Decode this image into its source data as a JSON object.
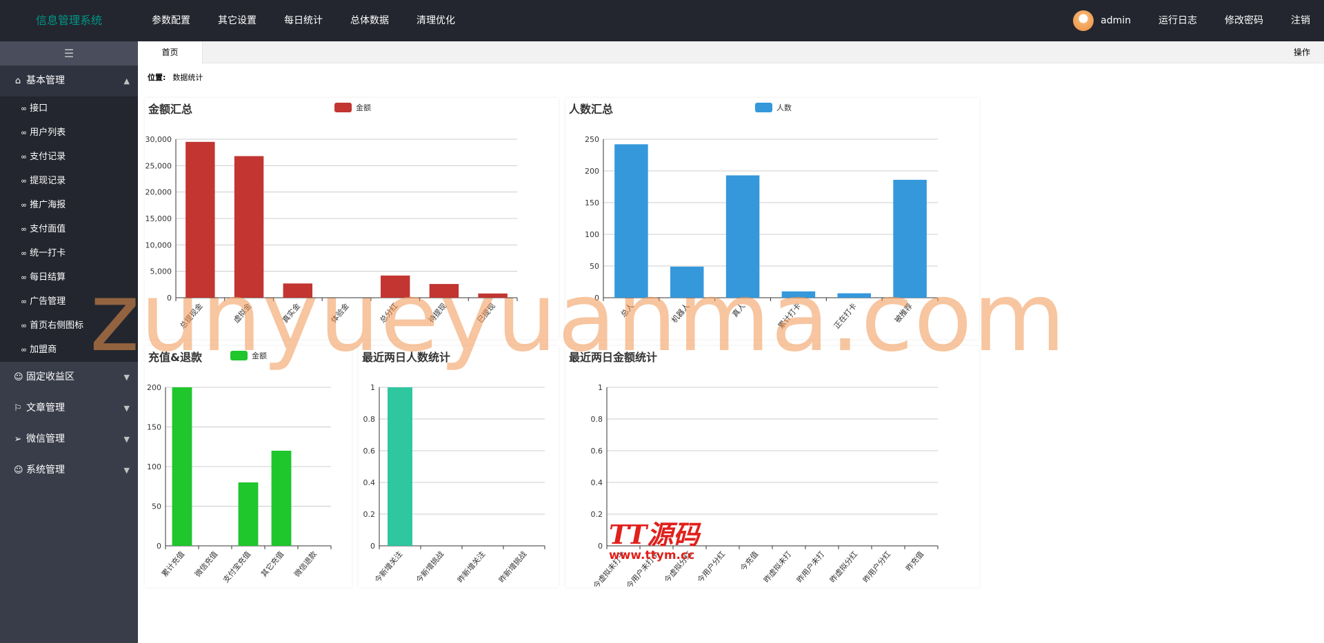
{
  "header": {
    "logo": "信息管理系统",
    "nav": [
      "参数配置",
      "其它设置",
      "每日统计",
      "总体数据",
      "清理优化"
    ],
    "user": "admin",
    "right": [
      "运行日志",
      "修改密码",
      "注销"
    ]
  },
  "sidebar": {
    "toggle_icon": "☰",
    "groups": [
      {
        "label": "基本管理",
        "open": true,
        "icon": "home-icon",
        "items": [
          "接口",
          "用户列表",
          "支付记录",
          "提现记录",
          "推广海报",
          "支付面值",
          "统一打卡",
          "每日结算",
          "广告管理",
          "首页右侧图标",
          "加盟商"
        ]
      },
      {
        "label": "固定收益区",
        "icon": "user-icon"
      },
      {
        "label": "文章管理",
        "icon": "flag-icon"
      },
      {
        "label": "微信管理",
        "icon": "send-icon"
      },
      {
        "label": "系统管理",
        "icon": "user-icon"
      }
    ]
  },
  "tabs": {
    "home": "首页",
    "ops": "操作"
  },
  "breadcrumb": {
    "label": "位置:",
    "current": "数据统计"
  },
  "watermark": {
    "text": "zunyueyuanma.com",
    "brand": "TT源码",
    "url": "www.ttym.cc"
  },
  "colors": {
    "red": "#c23531",
    "blue": "#3498db",
    "green": "#1fc62c",
    "teal": "#2ec7a0"
  },
  "chart_data": [
    {
      "id": "amount",
      "type": "bar",
      "title": "金额汇总",
      "legend": "金额",
      "color": "#c23531",
      "categories": [
        "总提现金",
        "虚拟金",
        "真实金",
        "体验金",
        "总分红",
        "待提现",
        "已提现"
      ],
      "values": [
        29500,
        26800,
        2700,
        0,
        4200,
        2600,
        800
      ],
      "ylim": [
        0,
        30000
      ],
      "yticks": [
        "0",
        "5,000",
        "10,000",
        "15,000",
        "20,000",
        "25,000",
        "30,000"
      ]
    },
    {
      "id": "people",
      "type": "bar",
      "title": "人数汇总",
      "legend": "人数",
      "color": "#3498db",
      "categories": [
        "总人",
        "机器人",
        "真人",
        "累计打卡",
        "正在打卡",
        "被推荐"
      ],
      "values": [
        242,
        49,
        193,
        10,
        7,
        186
      ],
      "ylim": [
        0,
        250
      ],
      "yticks": [
        "0",
        "50",
        "100",
        "150",
        "200",
        "250"
      ]
    },
    {
      "id": "recharge",
      "type": "bar",
      "title": "充值&退款",
      "legend": "金额",
      "color": "#1fc62c",
      "categories": [
        "累计充值",
        "微信充值",
        "支付宝充值",
        "其它充值",
        "微信退款"
      ],
      "values": [
        200,
        0,
        80,
        120,
        0
      ],
      "ylim": [
        0,
        200
      ],
      "yticks": [
        "0",
        "50",
        "100",
        "150",
        "200"
      ]
    },
    {
      "id": "twoday_people",
      "type": "bar",
      "title": "最近两日人数统计",
      "color": "#2ec7a0",
      "categories": [
        "今新增关注",
        "今新增挑战",
        "昨新增关注",
        "昨新增挑战"
      ],
      "values": [
        1,
        0,
        0,
        0
      ],
      "ylim": [
        0,
        1
      ],
      "yticks": [
        "0",
        "0.2",
        "0.4",
        "0.6",
        "0.8",
        "1"
      ]
    },
    {
      "id": "twoday_amount",
      "type": "bar",
      "title": "最近两日金额统计",
      "color": "#c23531",
      "categories": [
        "今虚拟未打卡",
        "今用户未打卡",
        "今虚拟分红",
        "今用户分红",
        "今充值",
        "昨虚拟未打",
        "昨用户未打",
        "昨虚拟分红",
        "昨用户分红",
        "昨充值"
      ],
      "values": [
        0,
        0,
        0,
        0,
        0,
        0,
        0,
        0,
        0,
        0
      ],
      "ylim": [
        0,
        1
      ],
      "yticks": [
        "0",
        "0.2",
        "0.4",
        "0.6",
        "0.8",
        "1"
      ]
    }
  ]
}
